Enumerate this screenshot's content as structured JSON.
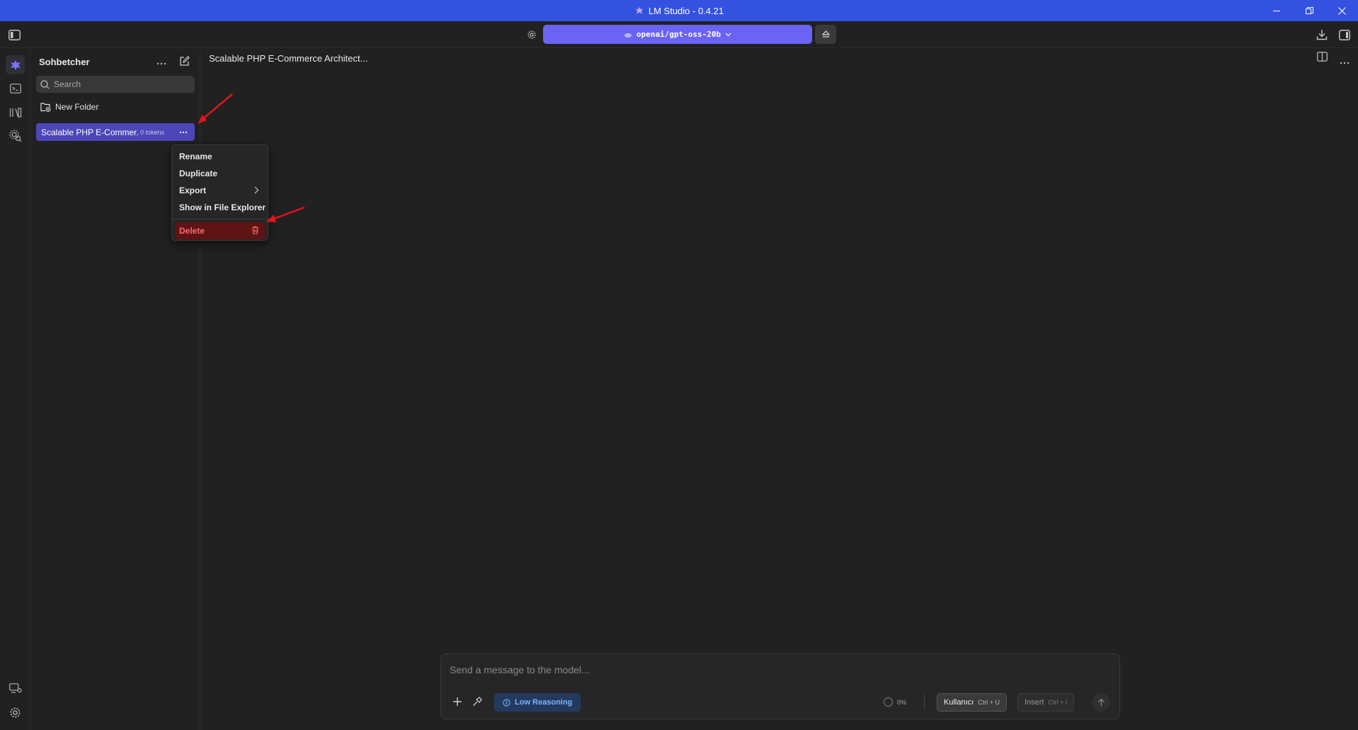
{
  "window": {
    "title": "LM Studio - 0.4.21"
  },
  "toolbar": {
    "model_name": "openai/gpt-oss-20b"
  },
  "sidebar": {
    "header": "Sohbetcher",
    "search_placeholder": "Search",
    "new_folder_label": "New Folder",
    "chats": [
      {
        "name": "Scalable PHP E-Commer...",
        "tokens": "0 tokens"
      }
    ]
  },
  "context_menu": {
    "items": [
      "Rename",
      "Duplicate",
      "Export",
      "Show in File Explorer"
    ],
    "delete_label": "Delete"
  },
  "main": {
    "chat_title": "Scalable PHP E-Commerce Architect..."
  },
  "composer": {
    "placeholder": "Send a message to the model...",
    "reasoning_label": "Low Reasoning",
    "context_usage": "0%",
    "role_label": "Kullanıcı",
    "role_shortcut": "Ctrl + U",
    "insert_label": "Insert",
    "insert_shortcut": "Ctrl + I"
  },
  "colors": {
    "titlebar": "#3452e0",
    "accent": "#6a63f5",
    "selected_chat": "#4c47b8",
    "delete_bg": "#5e1414",
    "delete_text": "#ff6b6b",
    "annotation_arrow": "#e0141e"
  },
  "icons": [
    "lmstudio-logo-icon",
    "minimize-icon",
    "restore-icon",
    "close-icon",
    "sidebar-toggle-icon",
    "settings-gear-icon",
    "chevron-down-icon",
    "eject-icon",
    "download-icon",
    "right-panel-icon",
    "chat-icon",
    "terminal-icon",
    "library-icon",
    "discover-icon",
    "server-icon",
    "gear-icon",
    "compose-icon",
    "search-icon",
    "folder-plus-icon",
    "more-icon",
    "chevron-right-icon",
    "trash-icon",
    "split-view-icon",
    "plus-icon",
    "tools-icon",
    "info-icon",
    "send-arrow-icon"
  ]
}
